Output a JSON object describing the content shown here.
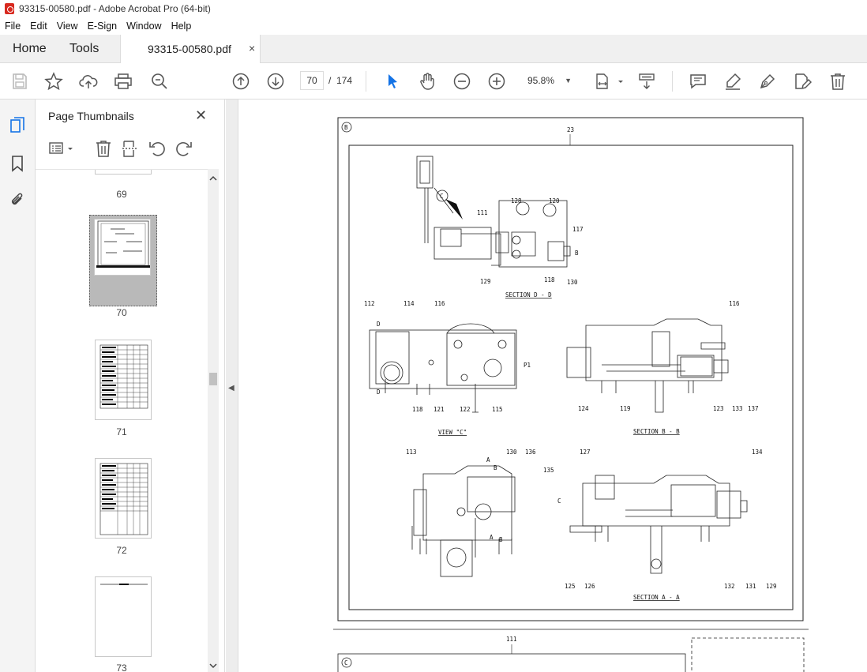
{
  "window": {
    "title": "93315-00580.pdf - Adobe Acrobat Pro (64-bit)"
  },
  "menu": [
    "File",
    "Edit",
    "View",
    "E-Sign",
    "Window",
    "Help"
  ],
  "tabs": {
    "home": "Home",
    "tools": "Tools",
    "document": "93315-00580.pdf",
    "close": "×"
  },
  "toolbar": {
    "current_page": "70",
    "page_sep": "/",
    "total_pages": "174",
    "zoom": "95.8%"
  },
  "panel": {
    "title": "Page Thumbnails",
    "close": "✕",
    "thumbnails": [
      "69",
      "70",
      "71",
      "72",
      "73"
    ],
    "selected": "70"
  },
  "drawing": {
    "sheet_mark_top": "B",
    "sheet_mark_bottom": "C",
    "top_ref": "23",
    "bottom_ref": "111",
    "view_mark": "C",
    "section_d": "SECTION D - D",
    "section_b": "SECTION B - B",
    "section_a": "SECTION A - A",
    "view_c": "VIEW \"C\"",
    "p1": "P1",
    "letter_b": "B",
    "letter_c": "C",
    "letter_d": "D",
    "letter_a": "A",
    "callouts_d": [
      "111",
      "128",
      "120",
      "117",
      "129",
      "118",
      "130"
    ],
    "callouts_view": [
      "112",
      "114",
      "116",
      "118",
      "121",
      "122",
      "115"
    ],
    "callouts_b": [
      "116",
      "124",
      "119",
      "123",
      "133",
      "137"
    ],
    "callouts_a1": [
      "113",
      "130",
      "136"
    ],
    "callouts_a2": [
      "127",
      "135",
      "134",
      "125",
      "126",
      "132",
      "131",
      "129"
    ]
  },
  "colors": {
    "accent": "#1473e6",
    "tab_bg": "#f0f0f0",
    "panel_border": "#dcdcdc"
  }
}
